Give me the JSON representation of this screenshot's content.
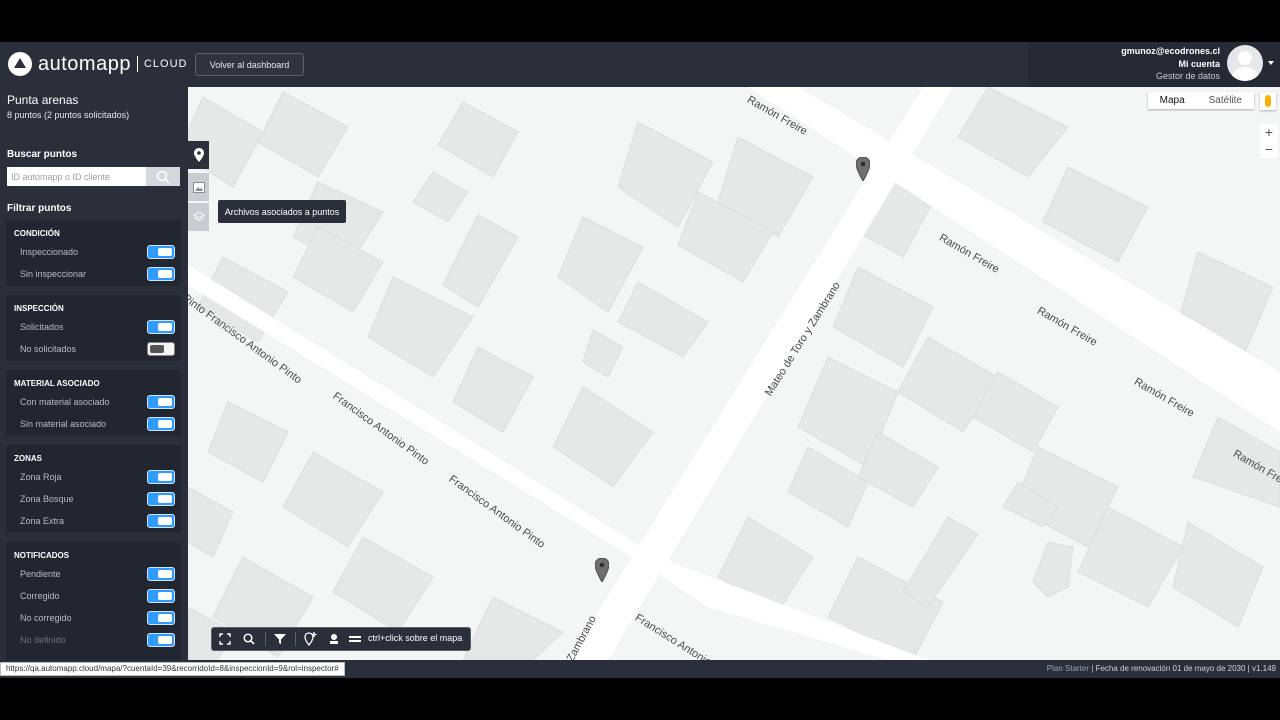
{
  "header": {
    "brand": "automapp",
    "brand_suffix": "CLOUD",
    "back_button": "Volver al dashboard",
    "user_email": "gmunoz@ecodrones.cl",
    "account_link": "Mi cuenta",
    "role": "Gestor de datos"
  },
  "sidebar": {
    "project_title": "Punta arenas",
    "project_subtitle": "8 puntos (2 puntos solicitados)",
    "search_heading": "Buscar puntos",
    "search_placeholder": "ID automapp o ID cliente",
    "filter_heading": "Filtrar puntos",
    "groups": [
      {
        "title": "CONDICIÓN",
        "items": [
          {
            "label": "Inspeccionado",
            "on": true
          },
          {
            "label": "Sin inspeccionar",
            "on": true
          }
        ]
      },
      {
        "title": "INSPECCIÓN",
        "items": [
          {
            "label": "Solicitados",
            "on": true
          },
          {
            "label": "No solicitados",
            "on": false
          }
        ]
      },
      {
        "title": "MATERIAL ASOCIADO",
        "items": [
          {
            "label": "Con material asociado",
            "on": true
          },
          {
            "label": "Sin material asociado",
            "on": true
          }
        ]
      },
      {
        "title": "ZONAS",
        "items": [
          {
            "label": "Zona Roja",
            "on": true
          },
          {
            "label": "Zona Bosque",
            "on": true
          },
          {
            "label": "Zona Extra",
            "on": true
          }
        ]
      },
      {
        "title": "NOTIFICADOS",
        "items": [
          {
            "label": "Pendiente",
            "on": true
          },
          {
            "label": "Corregido",
            "on": true
          },
          {
            "label": "No corregido",
            "on": true
          },
          {
            "label": "No definido",
            "on": true
          }
        ]
      }
    ]
  },
  "map": {
    "type_options": [
      "Mapa",
      "Satélite"
    ],
    "zoom_in": "+",
    "zoom_out": "−",
    "streets": {
      "s1": "Ramón Freire",
      "s2": "Ramón Freire",
      "s3": "Ramón Freire",
      "s4": "Ramón Freire",
      "s5": "Ramón Freire",
      "s6": "Mateo de Toro y Zambrano",
      "s7": "Pinto Francisco Antonio Pinto",
      "s8": "Francisco Antonio Pinto",
      "s9": "Francisco Antonio Pinto",
      "s10": "Francisco Antonio",
      "s11": "Zambrano"
    }
  },
  "tools": {
    "tooltip": "Archivos asociados a puntos",
    "hint": "ctrl+click sobre el mapa"
  },
  "status": {
    "url": "https://qa.automapp.cloud/mapa/?cuentaId=39&recorridoId=8&inspeccionId=9&rol=inspector#",
    "plan": "Plan Starter",
    "renewal": "| Fecha de renovación 01 de mayo de 2030 | v1.149"
  },
  "colors": {
    "toggle_on": "#2f9bff",
    "panel_bg": "#2a2f3a",
    "map_bg": "#f4f6f5"
  }
}
